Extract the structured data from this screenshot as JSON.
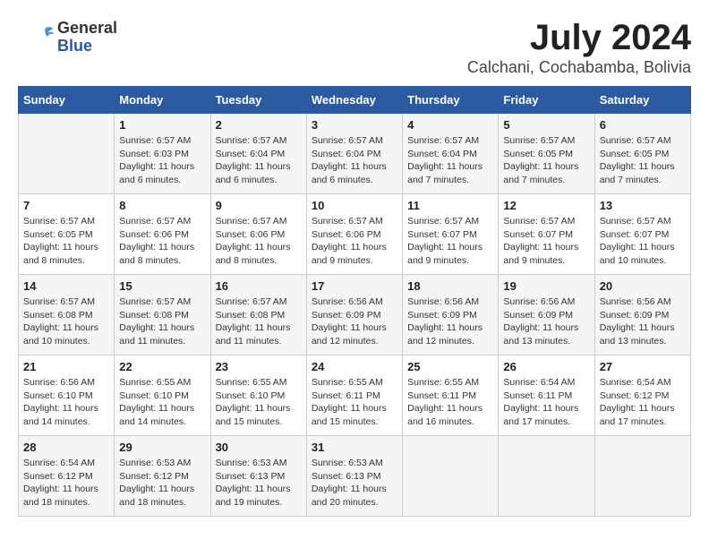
{
  "header": {
    "logo_general": "General",
    "logo_blue": "Blue",
    "month": "July 2024",
    "location": "Calchani, Cochabamba, Bolivia"
  },
  "days_of_week": [
    "Sunday",
    "Monday",
    "Tuesday",
    "Wednesday",
    "Thursday",
    "Friday",
    "Saturday"
  ],
  "weeks": [
    [
      {
        "day": "",
        "info": ""
      },
      {
        "day": "1",
        "info": "Sunrise: 6:57 AM\nSunset: 6:03 PM\nDaylight: 11 hours\nand 6 minutes."
      },
      {
        "day": "2",
        "info": "Sunrise: 6:57 AM\nSunset: 6:04 PM\nDaylight: 11 hours\nand 6 minutes."
      },
      {
        "day": "3",
        "info": "Sunrise: 6:57 AM\nSunset: 6:04 PM\nDaylight: 11 hours\nand 6 minutes."
      },
      {
        "day": "4",
        "info": "Sunrise: 6:57 AM\nSunset: 6:04 PM\nDaylight: 11 hours\nand 7 minutes."
      },
      {
        "day": "5",
        "info": "Sunrise: 6:57 AM\nSunset: 6:05 PM\nDaylight: 11 hours\nand 7 minutes."
      },
      {
        "day": "6",
        "info": "Sunrise: 6:57 AM\nSunset: 6:05 PM\nDaylight: 11 hours\nand 7 minutes."
      }
    ],
    [
      {
        "day": "7",
        "info": "Sunrise: 6:57 AM\nSunset: 6:05 PM\nDaylight: 11 hours\nand 8 minutes."
      },
      {
        "day": "8",
        "info": "Sunrise: 6:57 AM\nSunset: 6:06 PM\nDaylight: 11 hours\nand 8 minutes."
      },
      {
        "day": "9",
        "info": "Sunrise: 6:57 AM\nSunset: 6:06 PM\nDaylight: 11 hours\nand 8 minutes."
      },
      {
        "day": "10",
        "info": "Sunrise: 6:57 AM\nSunset: 6:06 PM\nDaylight: 11 hours\nand 9 minutes."
      },
      {
        "day": "11",
        "info": "Sunrise: 6:57 AM\nSunset: 6:07 PM\nDaylight: 11 hours\nand 9 minutes."
      },
      {
        "day": "12",
        "info": "Sunrise: 6:57 AM\nSunset: 6:07 PM\nDaylight: 11 hours\nand 9 minutes."
      },
      {
        "day": "13",
        "info": "Sunrise: 6:57 AM\nSunset: 6:07 PM\nDaylight: 11 hours\nand 10 minutes."
      }
    ],
    [
      {
        "day": "14",
        "info": "Sunrise: 6:57 AM\nSunset: 6:08 PM\nDaylight: 11 hours\nand 10 minutes."
      },
      {
        "day": "15",
        "info": "Sunrise: 6:57 AM\nSunset: 6:08 PM\nDaylight: 11 hours\nand 11 minutes."
      },
      {
        "day": "16",
        "info": "Sunrise: 6:57 AM\nSunset: 6:08 PM\nDaylight: 11 hours\nand 11 minutes."
      },
      {
        "day": "17",
        "info": "Sunrise: 6:56 AM\nSunset: 6:09 PM\nDaylight: 11 hours\nand 12 minutes."
      },
      {
        "day": "18",
        "info": "Sunrise: 6:56 AM\nSunset: 6:09 PM\nDaylight: 11 hours\nand 12 minutes."
      },
      {
        "day": "19",
        "info": "Sunrise: 6:56 AM\nSunset: 6:09 PM\nDaylight: 11 hours\nand 13 minutes."
      },
      {
        "day": "20",
        "info": "Sunrise: 6:56 AM\nSunset: 6:09 PM\nDaylight: 11 hours\nand 13 minutes."
      }
    ],
    [
      {
        "day": "21",
        "info": "Sunrise: 6:56 AM\nSunset: 6:10 PM\nDaylight: 11 hours\nand 14 minutes."
      },
      {
        "day": "22",
        "info": "Sunrise: 6:55 AM\nSunset: 6:10 PM\nDaylight: 11 hours\nand 14 minutes."
      },
      {
        "day": "23",
        "info": "Sunrise: 6:55 AM\nSunset: 6:10 PM\nDaylight: 11 hours\nand 15 minutes."
      },
      {
        "day": "24",
        "info": "Sunrise: 6:55 AM\nSunset: 6:11 PM\nDaylight: 11 hours\nand 15 minutes."
      },
      {
        "day": "25",
        "info": "Sunrise: 6:55 AM\nSunset: 6:11 PM\nDaylight: 11 hours\nand 16 minutes."
      },
      {
        "day": "26",
        "info": "Sunrise: 6:54 AM\nSunset: 6:11 PM\nDaylight: 11 hours\nand 17 minutes."
      },
      {
        "day": "27",
        "info": "Sunrise: 6:54 AM\nSunset: 6:12 PM\nDaylight: 11 hours\nand 17 minutes."
      }
    ],
    [
      {
        "day": "28",
        "info": "Sunrise: 6:54 AM\nSunset: 6:12 PM\nDaylight: 11 hours\nand 18 minutes."
      },
      {
        "day": "29",
        "info": "Sunrise: 6:53 AM\nSunset: 6:12 PM\nDaylight: 11 hours\nand 18 minutes."
      },
      {
        "day": "30",
        "info": "Sunrise: 6:53 AM\nSunset: 6:13 PM\nDaylight: 11 hours\nand 19 minutes."
      },
      {
        "day": "31",
        "info": "Sunrise: 6:53 AM\nSunset: 6:13 PM\nDaylight: 11 hours\nand 20 minutes."
      },
      {
        "day": "",
        "info": ""
      },
      {
        "day": "",
        "info": ""
      },
      {
        "day": "",
        "info": ""
      }
    ]
  ]
}
